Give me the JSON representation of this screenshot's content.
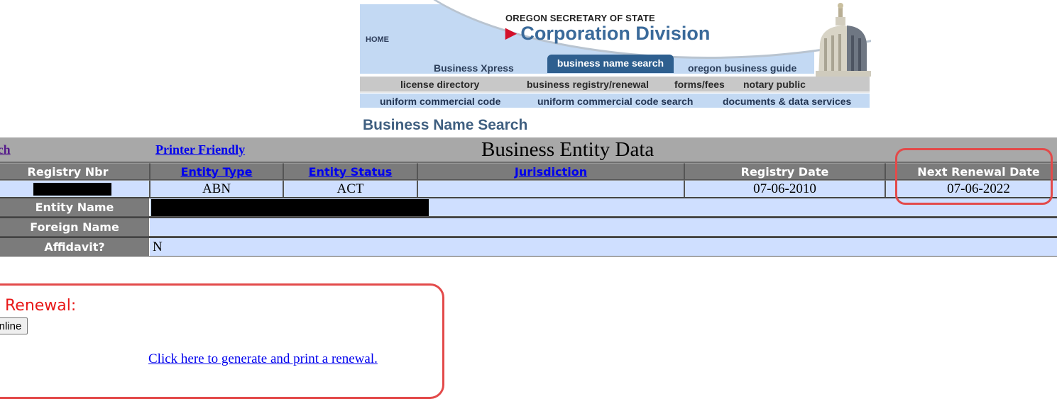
{
  "banner": {
    "home_label": "HOME",
    "agency": "OREGON SECRETARY OF STATE",
    "division": "Corporation Division",
    "arrow_icon": "triangle-right-icon",
    "tabs": [
      {
        "label": "Business Xpress",
        "active": false
      },
      {
        "label": "business name search",
        "active": true
      },
      {
        "label": "oregon business guide",
        "active": false
      }
    ],
    "nav_row_1": [
      "license directory",
      "business registry/renewal",
      "forms/fees",
      "notary public"
    ],
    "nav_row_2": [
      "uniform commercial code",
      "uniform commercial code search",
      "documents & data services"
    ],
    "image": "capitol-dome-icon"
  },
  "page": {
    "title": "Business Name Search"
  },
  "entity": {
    "search_link": "arch",
    "printer_friendly": "Printer Friendly",
    "section_title": "Business Entity Data",
    "columns": [
      {
        "label": "Registry Nbr",
        "link": false
      },
      {
        "label": "Entity Type",
        "link": true
      },
      {
        "label": "Entity Status",
        "link": true
      },
      {
        "label": "Jurisdiction",
        "link": true
      },
      {
        "label": "Registry Date",
        "link": false
      },
      {
        "label": "Next Renewal Date",
        "link": false
      }
    ],
    "row": {
      "registry_nbr": "[redacted]",
      "entity_type": "ABN",
      "entity_status": "ACT",
      "jurisdiction": "",
      "registry_date": "07-06-2010",
      "next_renewal_date": "07-06-2022"
    },
    "fields": [
      {
        "label": "Entity Name",
        "value": "[redacted]"
      },
      {
        "label": "Foreign Name",
        "value": ""
      },
      {
        "label": "Affidavit?",
        "value": "N"
      }
    ]
  },
  "renewal": {
    "label": "Renewal:",
    "online_button": "Online",
    "generate_link": "Click here to generate and print a renewal."
  },
  "annotations": {
    "color": "#e34a4a"
  }
}
